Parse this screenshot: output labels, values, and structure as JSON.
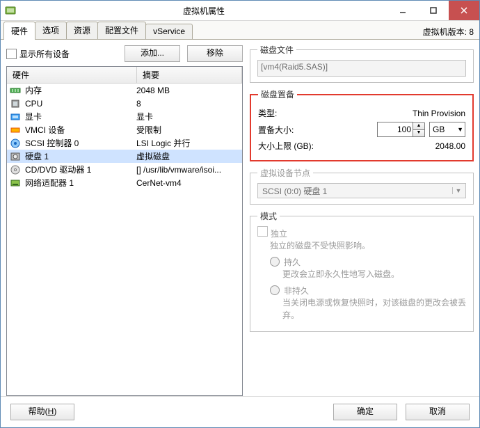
{
  "window": {
    "title": "虚拟机属性"
  },
  "tabs": [
    "硬件",
    "选项",
    "资源",
    "配置文件",
    "vService"
  ],
  "version_label": "虚拟机版本: 8",
  "left": {
    "show_all": "显示所有设备",
    "add_btn": "添加...",
    "remove_btn": "移除",
    "cols": {
      "hw": "硬件",
      "sum": "摘要"
    },
    "rows": [
      {
        "icon": "ram-icon",
        "name": "内存",
        "sum": "2048 MB"
      },
      {
        "icon": "cpu-icon",
        "name": "CPU",
        "sum": "8"
      },
      {
        "icon": "video-icon",
        "name": "显卡",
        "sum": "显卡"
      },
      {
        "icon": "vmci-icon",
        "name": "VMCI 设备",
        "sum": "受限制"
      },
      {
        "icon": "scsi-icon",
        "name": "SCSI 控制器 0",
        "sum": "LSI Logic 并行"
      },
      {
        "icon": "disk-icon",
        "name": "硬盘 1",
        "sum": "虚拟磁盘",
        "selected": true
      },
      {
        "icon": "cd-icon",
        "name": "CD/DVD 驱动器 1",
        "sum": "[] /usr/lib/vmware/isoi..."
      },
      {
        "icon": "nic-icon",
        "name": "网络适配器 1",
        "sum": "CerNet-vm4"
      }
    ]
  },
  "diskfile": {
    "legend": "磁盘文件",
    "value": "[vm4(Raid5.SAS)]"
  },
  "provision": {
    "legend": "磁盘置备",
    "type_label": "类型:",
    "type_value": "Thin Provision",
    "size_label": "置备大小:",
    "size_value": "100",
    "size_unit": "GB",
    "max_label": "大小上限 (GB):",
    "max_value": "2048.00"
  },
  "vnode": {
    "legend": "虚拟设备节点",
    "value": "SCSI (0:0) 硬盘 1"
  },
  "mode": {
    "legend": "模式",
    "independent": "独立",
    "independent_help": "独立的磁盘不受快照影响。",
    "persistent": "持久",
    "persistent_help": "更改会立即永久性地写入磁盘。",
    "nonpersistent": "非持久",
    "nonpersistent_help": "当关闭电源或恢复快照时，对该磁盘的更改会被丢弃。"
  },
  "footer": {
    "help": "帮助(",
    "help_u": "H",
    "help_end": ")",
    "ok": "确定",
    "cancel": "取消"
  }
}
